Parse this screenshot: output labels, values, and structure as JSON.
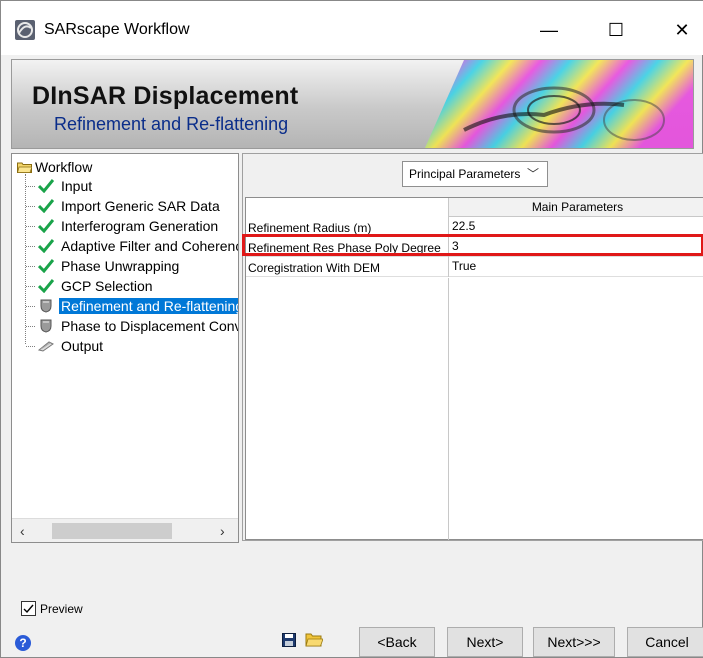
{
  "window": {
    "title": "SARscape Workflow",
    "controls": {
      "minimize": "—",
      "maximize": "☐",
      "close": "✕"
    }
  },
  "banner": {
    "title": "DInSAR Displacement",
    "subtitle": "Refinement and Re-flattening"
  },
  "tree": {
    "root": "Workflow",
    "items": [
      {
        "label": "Input",
        "status": "done"
      },
      {
        "label": "Import Generic SAR Data",
        "status": "done"
      },
      {
        "label": "Interferogram Generation",
        "status": "done"
      },
      {
        "label": "Adaptive Filter and Coherence",
        "status": "done"
      },
      {
        "label": "Phase Unwrapping",
        "status": "done"
      },
      {
        "label": "GCP Selection",
        "status": "done"
      },
      {
        "label": "Refinement and Re-flattening",
        "status": "current",
        "selected": true
      },
      {
        "label": "Phase to Displacement Conversion",
        "status": "pending"
      },
      {
        "label": "Output",
        "status": "output"
      }
    ]
  },
  "params": {
    "dropdown_value": "Principal Parameters",
    "column_header": "Main Parameters",
    "rows": [
      {
        "name": "Refinement Radius (m)",
        "value": "22.5"
      },
      {
        "name": "Refinement Res Phase Poly Degree",
        "value": "3"
      },
      {
        "name": "Coregistration With DEM",
        "value": "True"
      }
    ]
  },
  "footer": {
    "preview_label": "Preview",
    "preview_checked": true,
    "help": "?",
    "buttons": {
      "back": "<Back",
      "next": "Next>",
      "next_all": "Next>>>",
      "cancel": "Cancel"
    }
  },
  "colors": {
    "selection": "#0078d7",
    "check": "#1aa34a",
    "highlight": "#e01818",
    "banner_subtitle": "#0a2d8a"
  }
}
